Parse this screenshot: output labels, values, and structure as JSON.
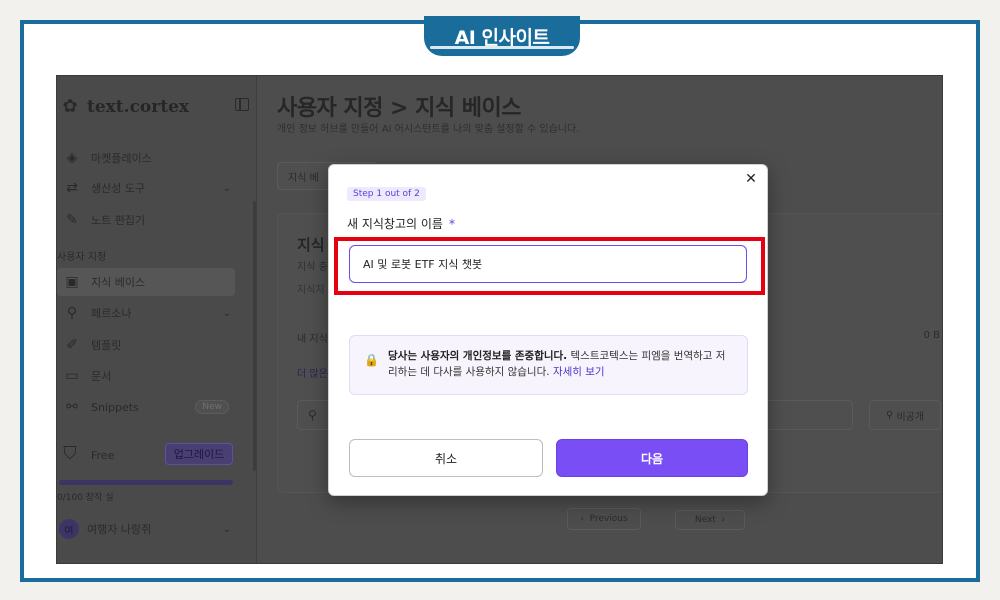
{
  "brand": {
    "label": "AI 인사이트"
  },
  "sidebar": {
    "logo_text": "text.cortex",
    "items": [
      {
        "label": "마켓플레이스",
        "icon": "layers-icon"
      },
      {
        "label": "생산성 도구",
        "icon": "repeat-icon"
      },
      {
        "label": "노트 편집기",
        "icon": "pencil-icon"
      }
    ],
    "section_label": "사용자 지정",
    "custom_items": [
      {
        "label": "지식 베이스",
        "icon": "book-icon"
      },
      {
        "label": "페르소나",
        "icon": "person-icon"
      },
      {
        "label": "템플릿",
        "icon": "template-icon"
      },
      {
        "label": "문서",
        "icon": "folder-icon"
      },
      {
        "label": "Snippets",
        "icon": "snippet-icon",
        "badge": "New"
      }
    ],
    "plan_name": "Free",
    "upgrade_label": "업그레이드",
    "words_label": "0/100 창작 실",
    "words_progress": 1.0,
    "avatar_initial": "여",
    "user_name": "여행자 나랑쥐"
  },
  "main": {
    "title": "사용자 지정 > 지식 베이스",
    "subtitle": "개인 정보 허브를 만들어 AI 어시스턴트를 나의 맞춤 설정할 수 있습니다.",
    "tab_label": "지식 베",
    "card_title": "지식",
    "card_sub": "지식 충",
    "card_sub2": "지식저",
    "kb_row_label": "내 지식",
    "kb_row_size": "0 B",
    "more_link": "더 많은",
    "private_label": "비공개",
    "pager_prev": "Previous",
    "pager_next": "Next"
  },
  "modal": {
    "step": "Step 1 out of 2",
    "field_label": "새 지식창고의 이름",
    "required_mark": "*",
    "input_value": "AI 및 로봇 ETF 지식 챗봇",
    "privacy_bold": "당사는 사용자의 개인정보를 존중합니다.",
    "privacy_text": " 텍스트코텍스는 피엠을 번역하고 저리하는 데 다사를 사용하지 않습니다. ",
    "privacy_link": "자세히 보기",
    "cancel_label": "취소",
    "next_label": "다음"
  },
  "colors": {
    "frame": "#1a6d9a",
    "accent": "#7a4ef5",
    "highlight": "#e60012"
  }
}
